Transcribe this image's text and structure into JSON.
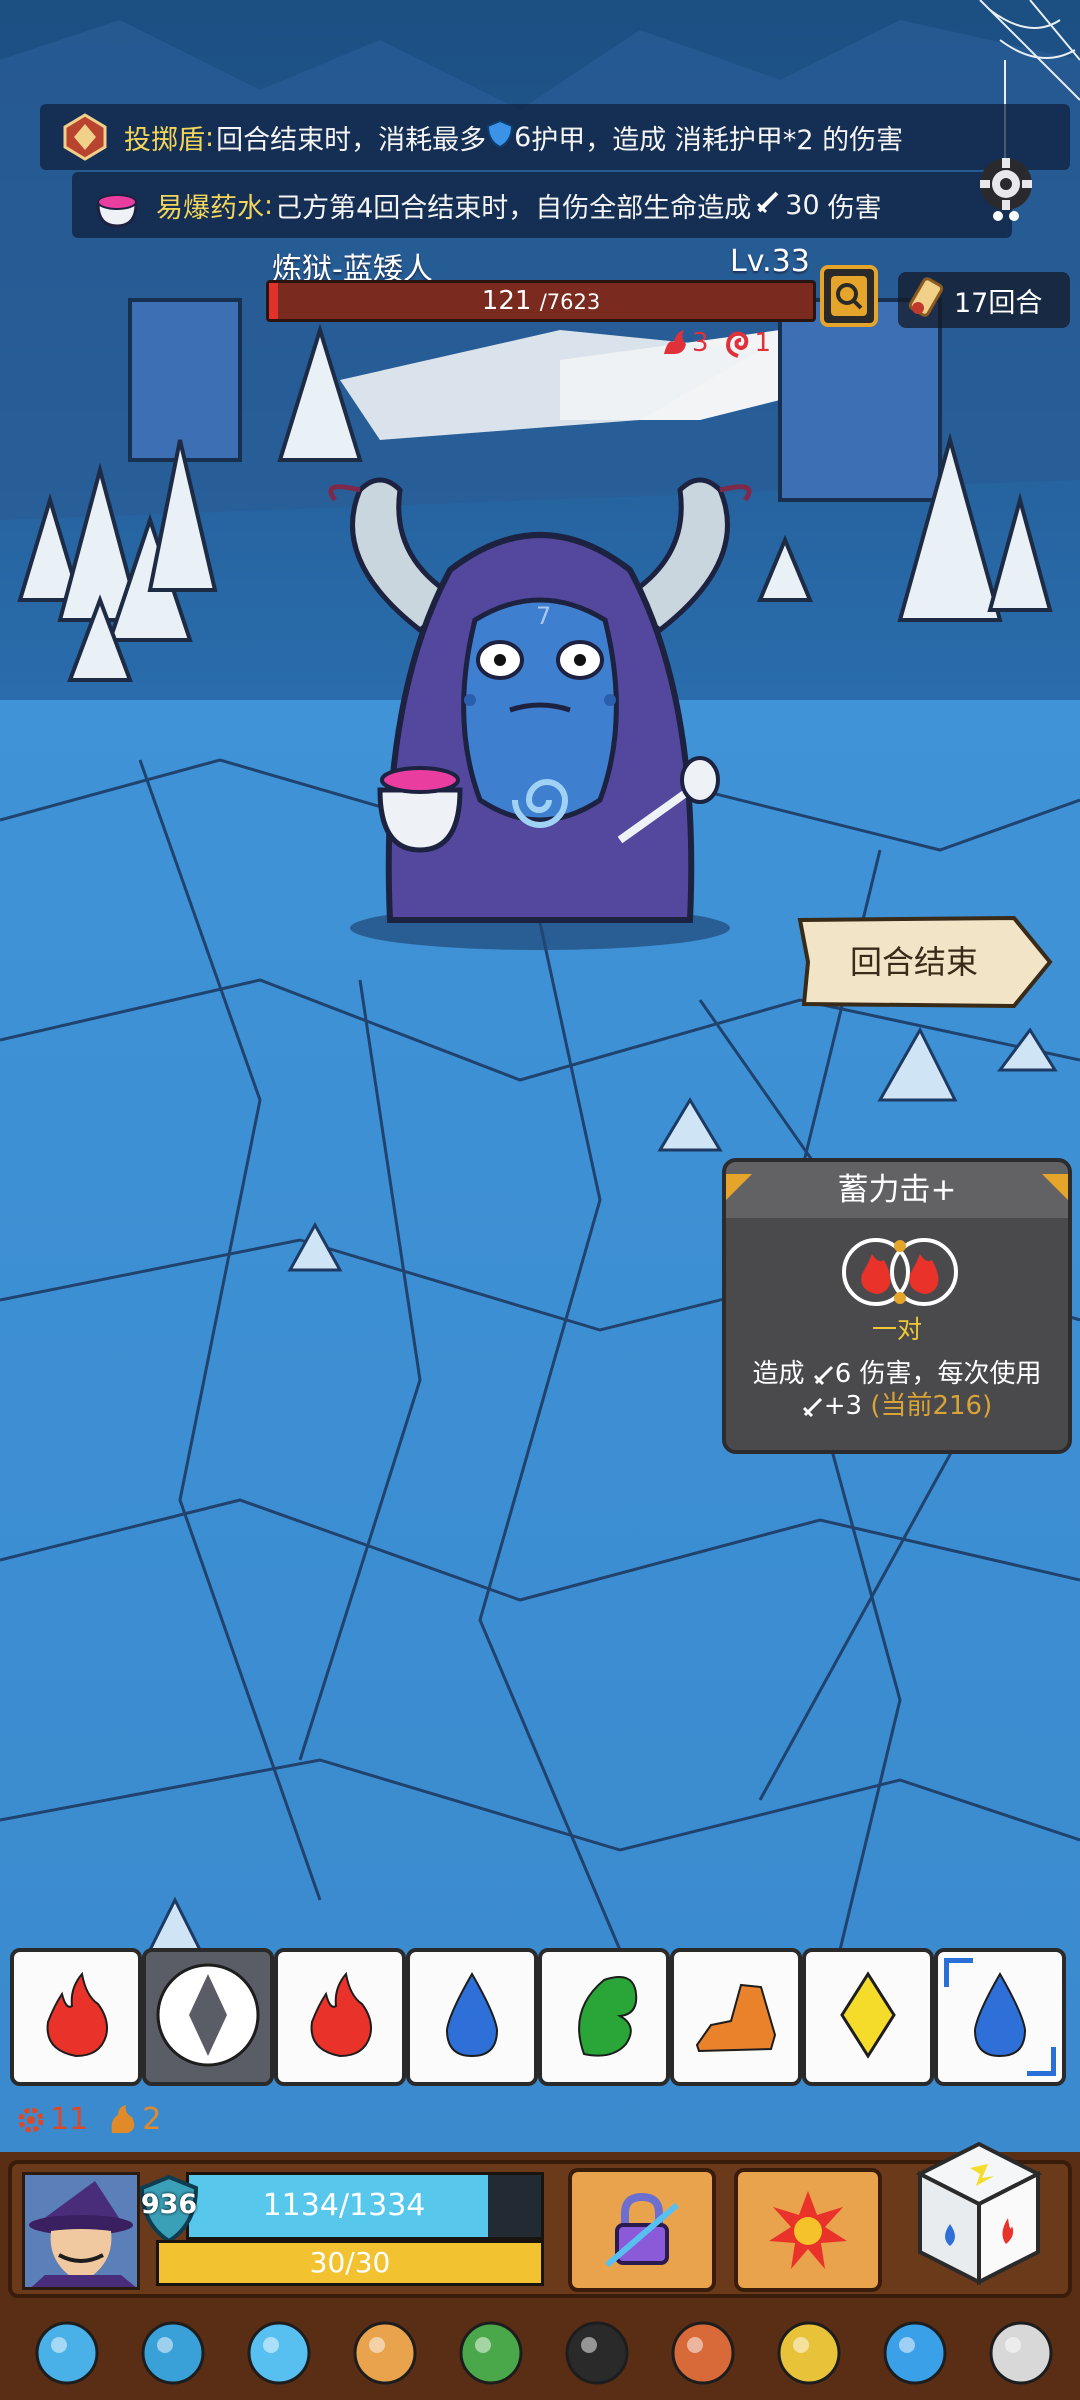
{
  "buffs": [
    {
      "icon": "shield-throw-icon",
      "name": "投掷盾",
      "separator": ":",
      "text_part1": " 回合结束时，消耗最多",
      "armor_value": "6",
      "text_part2": "护甲，造成 消耗护甲*2 的伤害"
    },
    {
      "icon": "explosive-potion-icon",
      "name": "易爆药水",
      "separator": ":",
      "text_part1": " 己方第4回合结束时，自伤全部生命造成",
      "damage_value": "30",
      "text_part2": "伤害"
    }
  ],
  "enemy": {
    "name": "炼狱-蓝矮人",
    "level": "Lv.33",
    "hp_current": "121",
    "hp_max": "/7623",
    "hp_fraction": 0.016,
    "number_on_hood": "7",
    "status_effects": [
      {
        "icon": "burn-icon",
        "value": "3",
        "color": "#e0303a"
      },
      {
        "icon": "flame-swirl-icon",
        "value": "1",
        "color": "#e0303a"
      }
    ]
  },
  "round": {
    "label": "17回合"
  },
  "end_turn": {
    "label": "回合结束"
  },
  "card_tip": {
    "title": "蓄力击+",
    "slot_label": "一对",
    "desc_prefix": "造成 ",
    "desc_damage": "6",
    "desc_mid": " 伤害，每次使用",
    "desc_bonus": "+3",
    "desc_current": "(当前216)"
  },
  "dice": [
    {
      "face": "fire",
      "color": "#e8322a",
      "selected": false
    },
    {
      "face": "diamond",
      "color": "#5a5d66",
      "selected": true
    },
    {
      "face": "fire",
      "color": "#e8322a",
      "selected": false
    },
    {
      "face": "water",
      "color": "#2f6fd8",
      "selected": false
    },
    {
      "face": "leaf",
      "color": "#2aa638",
      "selected": false
    },
    {
      "face": "rock",
      "color": "#e9822a",
      "selected": false
    },
    {
      "face": "diamond",
      "color": "#f5dc2a",
      "selected": false
    },
    {
      "face": "water",
      "color": "#2f6fd8",
      "selected": false,
      "special": true
    }
  ],
  "resources": [
    {
      "icon": "gear-burn-icon",
      "value": "11",
      "color": "#d84a2a"
    },
    {
      "icon": "flame-icon",
      "value": "2",
      "color": "#e08a2a"
    }
  ],
  "player": {
    "shield": "936",
    "hp_text": "1134/1334",
    "hp_fraction": 0.85,
    "energy_text": "30/30",
    "energy_fraction": 1.0
  },
  "skills": [
    {
      "icon": "lock-lightning-icon"
    },
    {
      "icon": "explosion-icon"
    }
  ],
  "items": [
    {
      "icon": "blue-hat-icon"
    },
    {
      "icon": "crystal-gem-icon"
    },
    {
      "icon": "ice-dagger-icon"
    },
    {
      "icon": "rune-shield-icon"
    },
    {
      "icon": "moss-block-icon"
    },
    {
      "icon": "black-bird-icon"
    },
    {
      "icon": "meat-leg-icon"
    },
    {
      "icon": "compass-bug-icon"
    },
    {
      "icon": "ice-cube-icon"
    },
    {
      "icon": "dragon-skull-icon"
    }
  ]
}
